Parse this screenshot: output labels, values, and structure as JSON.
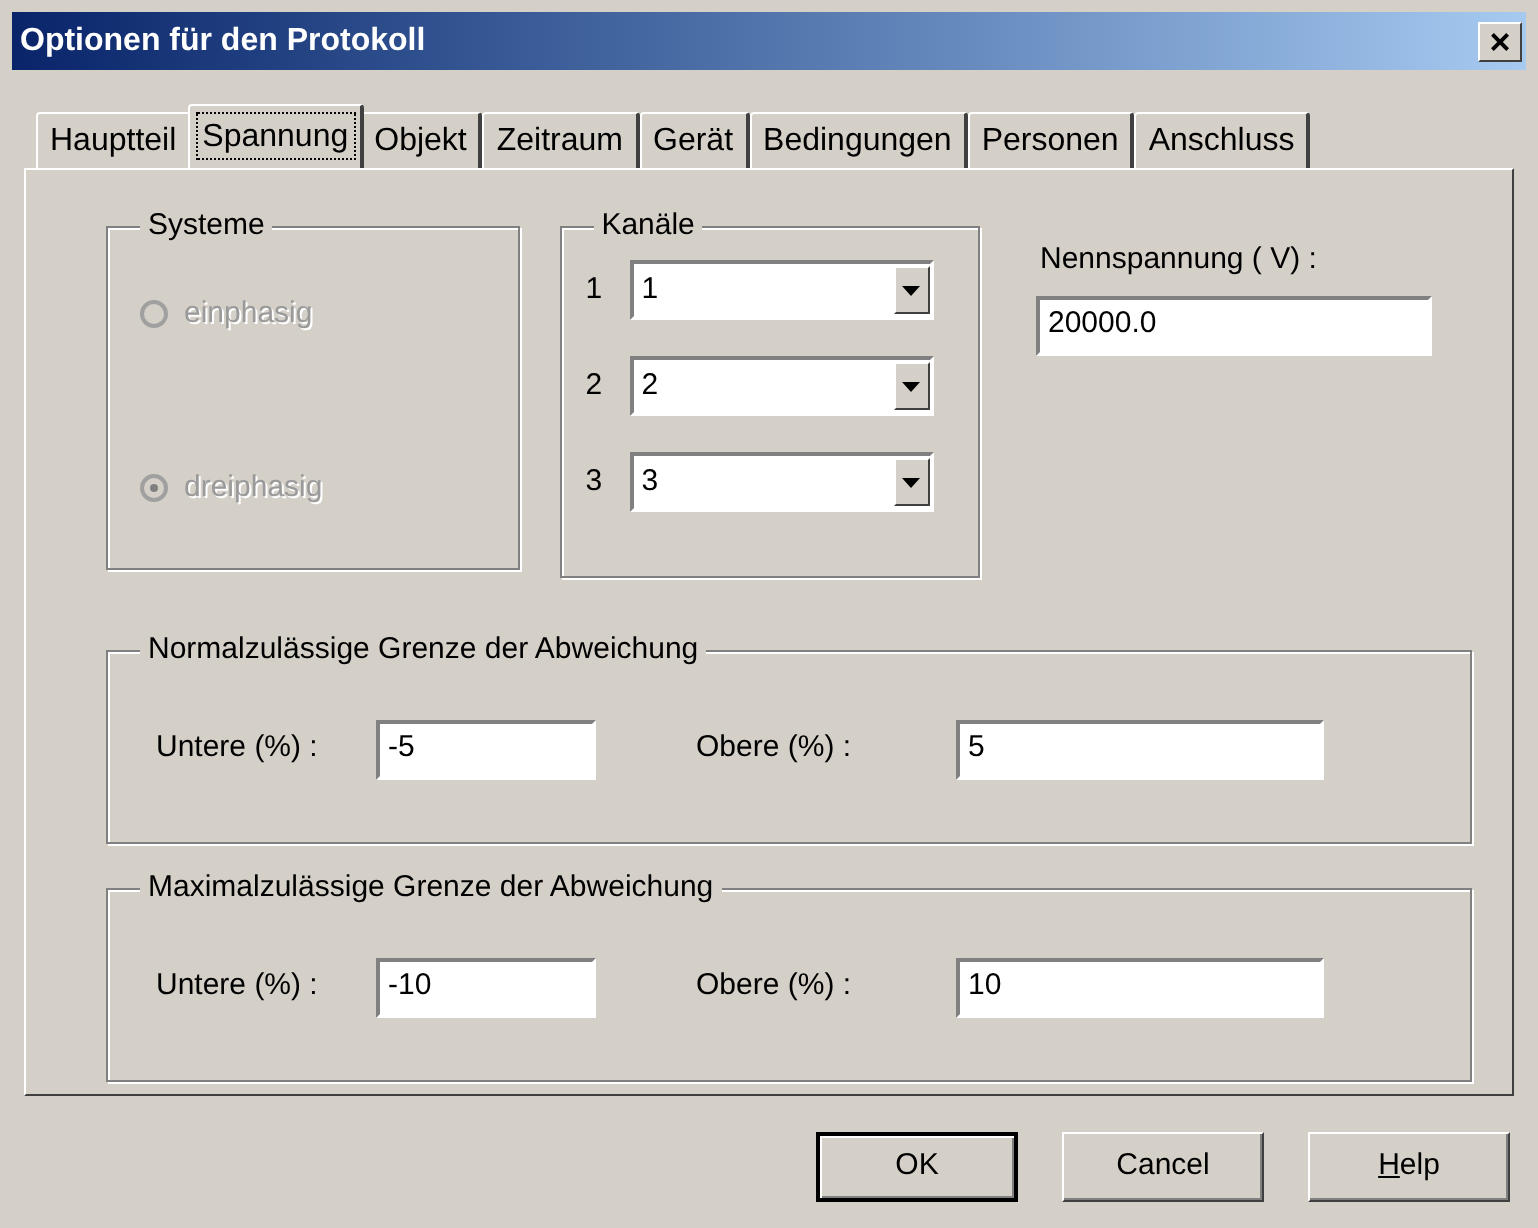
{
  "window": {
    "title": "Optionen für den Protokoll",
    "close": "×"
  },
  "tabs": [
    {
      "label": "Hauptteil",
      "selected": false
    },
    {
      "label": "Spannung",
      "selected": true
    },
    {
      "label": "Objekt",
      "selected": false
    },
    {
      "label": "Zeitraum",
      "selected": false
    },
    {
      "label": "Gerät",
      "selected": false
    },
    {
      "label": "Bedingungen",
      "selected": false
    },
    {
      "label": "Personen",
      "selected": false
    },
    {
      "label": "Anschluss",
      "selected": false
    }
  ],
  "systeme": {
    "title": "Systeme",
    "disabled": true,
    "options": [
      {
        "label": "einphasig",
        "selected": false
      },
      {
        "label": "dreiphasig",
        "selected": true
      }
    ]
  },
  "kanaele": {
    "title": "Kanäle",
    "rows": [
      {
        "label": "1",
        "value": "1"
      },
      {
        "label": "2",
        "value": "2"
      },
      {
        "label": "3",
        "value": "3"
      }
    ]
  },
  "nennspannung": {
    "label": "Nennspannung ( V) :",
    "value": "20000.0"
  },
  "limits": [
    {
      "title": "Normalzulässige Grenze der Abweichung",
      "lower_label": "Untere (%) :",
      "lower": "-5",
      "upper_label": "Obere (%) :",
      "upper": "5"
    },
    {
      "title": "Maximalzulässige Grenze der Abweichung",
      "lower_label": "Untere (%) :",
      "lower": "-10",
      "upper_label": "Obere (%) :",
      "upper": "10"
    }
  ],
  "buttons": [
    {
      "label": "OK",
      "default": true,
      "underline_first": false
    },
    {
      "label": "Cancel",
      "default": false,
      "underline_first": false
    },
    {
      "label": "Help",
      "default": false,
      "underline_first": true
    }
  ]
}
